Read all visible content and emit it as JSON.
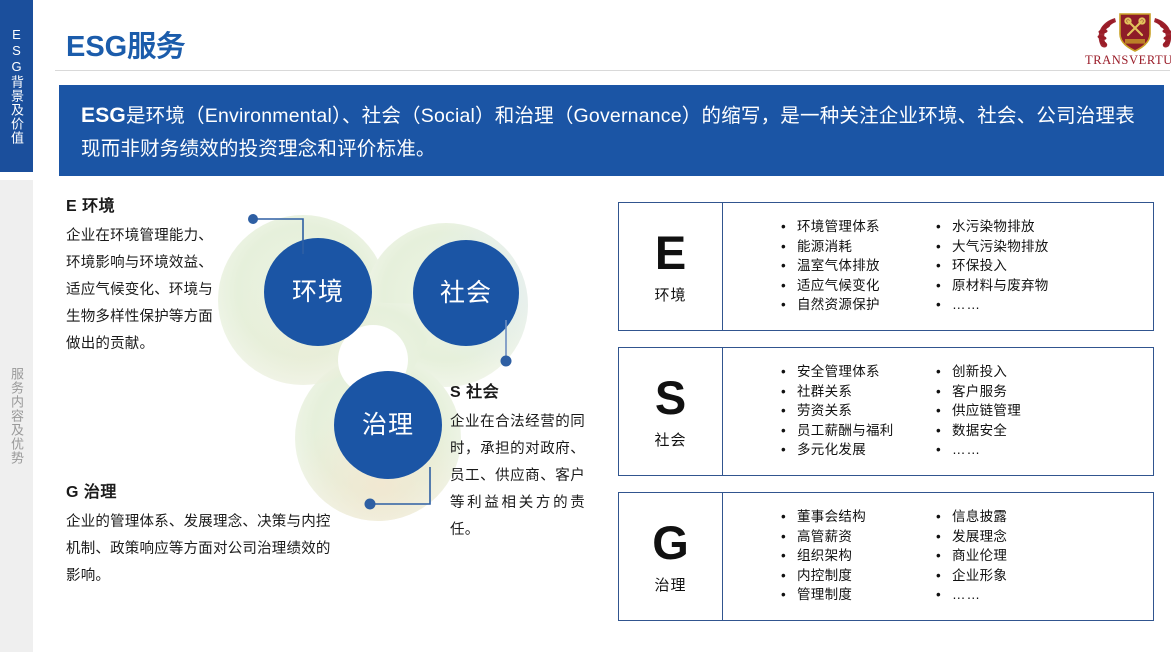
{
  "sidebar": {
    "tabs": [
      {
        "label": "ESG背景及价值",
        "active": true
      },
      {
        "label": "服务内容及优势",
        "active": false
      }
    ]
  },
  "header": {
    "title": "ESG服务",
    "logo_text": "TRANSVERTURE",
    "logo_icon": "crest-shield-crossed-keys-laurel"
  },
  "banner": {
    "emphasis": "ESG",
    "text": "是环境（Environmental）、社会（Social）和治理（Governance）的缩写，是一种关注企业环境、社会、公司治理表现而非财务绩效的投资理念和评价标准。",
    "bg_color": "#1B55A5"
  },
  "diagram": {
    "nodes": [
      {
        "id": "environment",
        "label": "环境"
      },
      {
        "id": "social",
        "label": "社会"
      },
      {
        "id": "governance",
        "label": "治理"
      }
    ],
    "node_color": "#1B55A5",
    "backdrop_color": "#EAF2E2",
    "connector_color": "#2E5FA3"
  },
  "descriptions": [
    {
      "id": "environment",
      "head": "E 环境",
      "body": "企业在环境管理能力、环境影响与环境效益、适应气候变化、环境与生物多样性保护等方面做出的贡献。"
    },
    {
      "id": "social",
      "head": "S 社会",
      "body": "企业在合法经营的同时，承担的对政府、员工、供应商、客户等利益相关方的责任。"
    },
    {
      "id": "governance",
      "head": "G 治理",
      "body": "企业的管理体系、发展理念、决策与内控机制、政策响应等方面对公司治理绩效的影响。"
    }
  ],
  "cards": [
    {
      "id": "environment",
      "letter": "E",
      "sub": "环境",
      "left_items": [
        "环境管理体系",
        "能源消耗",
        "温室气体排放",
        "适应气候变化",
        "自然资源保护"
      ],
      "right_items": [
        "水污染物排放",
        "大气污染物排放",
        "环保投入",
        "原材料与废弃物",
        "……"
      ]
    },
    {
      "id": "social",
      "letter": "S",
      "sub": "社会",
      "left_items": [
        "安全管理体系",
        "社群关系",
        "劳资关系",
        "员工薪酬与福利",
        "多元化发展"
      ],
      "right_items": [
        "创新投入",
        "客户服务",
        "供应链管理",
        "数据安全",
        "……"
      ]
    },
    {
      "id": "governance",
      "letter": "G",
      "sub": "治理",
      "left_items": [
        "董事会结构",
        "高管薪资",
        "组织架构",
        "内控制度",
        "管理制度"
      ],
      "right_items": [
        "信息披露",
        "发展理念",
        "商业伦理",
        "企业形象",
        "……"
      ]
    }
  ],
  "colors": {
    "brand_blue": "#1B55A5",
    "title_blue": "#1B5CAB",
    "card_border": "#31558F",
    "logo_red": "#9A1C28",
    "sidebar_inactive": "#EFEFEF"
  }
}
